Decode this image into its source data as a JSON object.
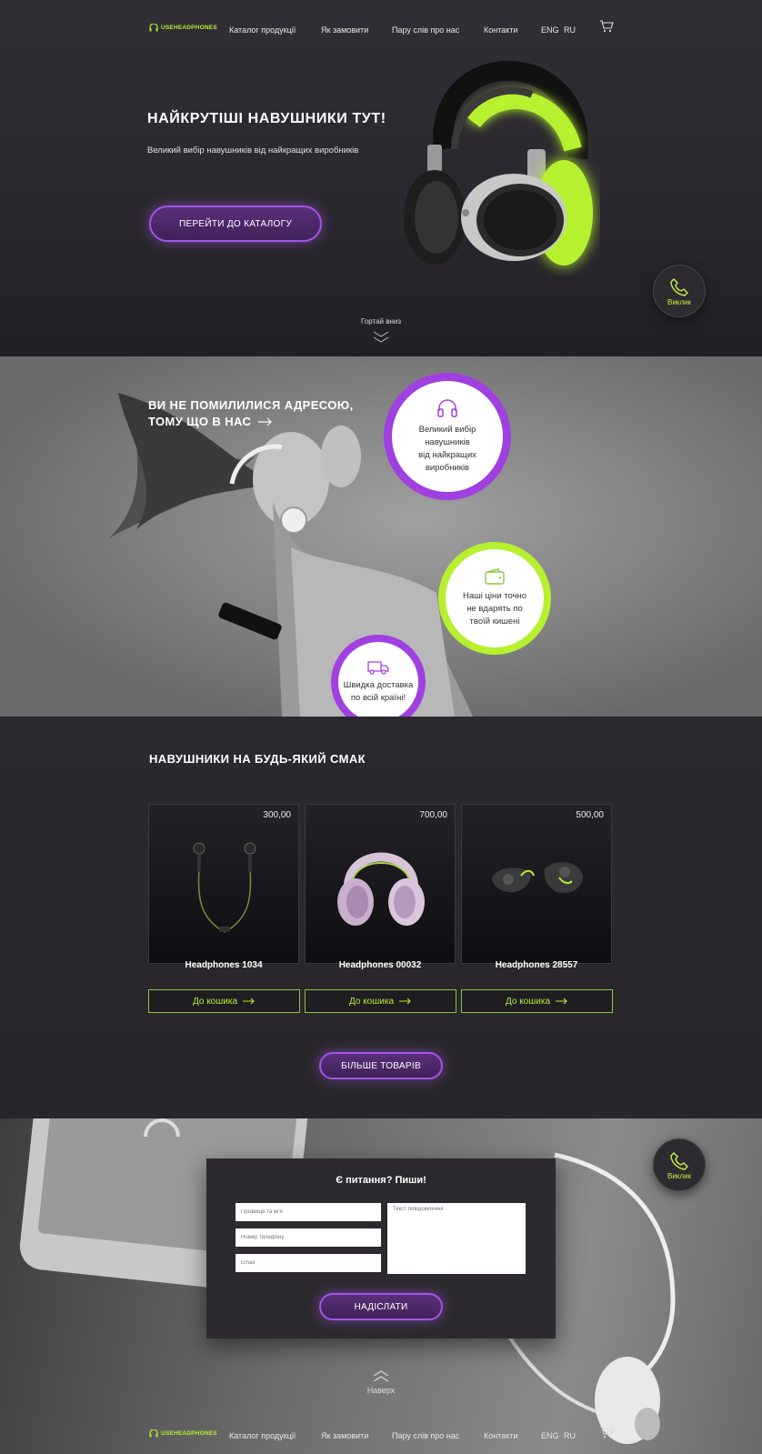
{
  "brand": {
    "logo_text": "USEHEADPHONES",
    "accent": "#b6f02f",
    "purple": "#a255e8"
  },
  "nav": {
    "items": [
      "Каталог продукції",
      "Як замовити",
      "Пару слів про нас",
      "Контакти"
    ],
    "lang_eng": "ENG",
    "lang_ru": "RU"
  },
  "hero": {
    "title": "НАЙКРУТІШІ НАВУШНИКИ ТУТ!",
    "subtitle": "Великий вибір навушників від найкращих виробників",
    "cta": "ПЕРЕЙТИ ДО КАТАЛОГУ",
    "scroll": "Гортай вниз"
  },
  "call": {
    "label": "Виклик"
  },
  "about": {
    "title_line1": "ВИ НЕ ПОМИЛИЛИСЯ АДРЕСОЮ,",
    "title_line2": "ТОМУ ЩО В НАС",
    "feature1": [
      "Великий вибір",
      "навушників",
      "від найкращих",
      "виробників"
    ],
    "feature2": [
      "Наші ціни точно",
      "не вдарять по",
      "твоїй кишені"
    ],
    "feature3": [
      "Швидка доставка",
      "по всій країні!"
    ]
  },
  "products": {
    "title": "НАВУШНИКИ НА БУДЬ-ЯКИЙ СМАК",
    "add_to_cart": "До кошика",
    "more": "БІЛЬШЕ ТОВАРІВ",
    "items": [
      {
        "name": "Headphones 1034",
        "price": "300,00"
      },
      {
        "name": "Headphones 00032",
        "price": "700,00"
      },
      {
        "name": "Headphones 28557",
        "price": "500,00"
      }
    ]
  },
  "contact": {
    "title": "Є питання? Пиши!",
    "name_ph": "Прізвище та ім'я",
    "phone_ph": "Номер телефону",
    "email_ph": "Email",
    "message_ph": "Текст повідомлення",
    "submit": "НАДІСЛАТИ",
    "to_top": "Наверх"
  }
}
